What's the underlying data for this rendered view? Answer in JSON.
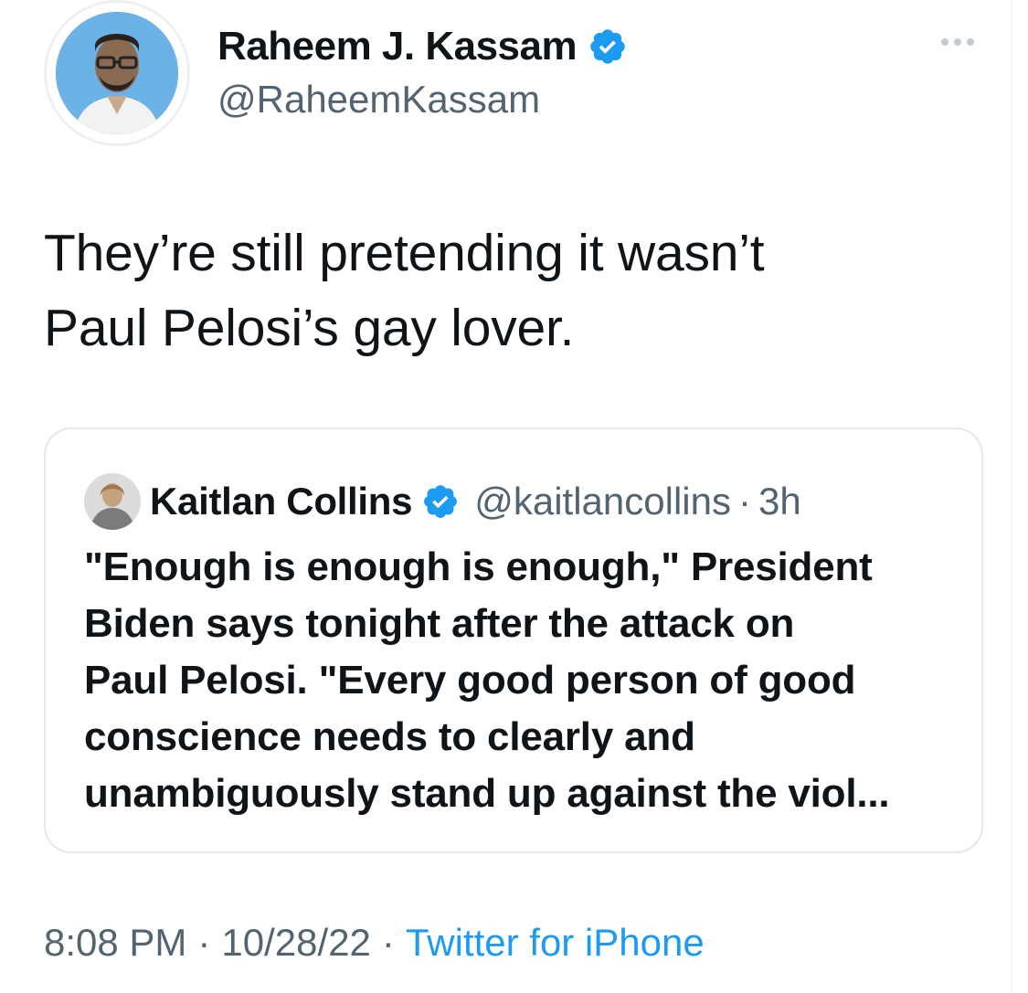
{
  "author": {
    "name": "Raheem J. Kassam",
    "handle": "@RaheemKassam",
    "verified": true
  },
  "tweet": {
    "text_line1": "They’re still pretending it wasn’t",
    "text_line2": "Paul Pelosi’s gay lover."
  },
  "quoted_tweet": {
    "name": "Kaitlan Collins",
    "handle": "@kaitlancollins",
    "separator": "·",
    "time": "3h",
    "verified": true,
    "lines": [
      "\"Enough is enough is enough,\" President",
      "Biden says tonight after the attack on",
      "Paul Pelosi. \"Every good person of good",
      "conscience needs to clearly and",
      "unambiguously stand up against the viol..."
    ]
  },
  "footer": {
    "time": "8:08 PM",
    "separator": "·",
    "date": "10/28/22",
    "source": "Twitter for iPhone"
  },
  "colors": {
    "text": "#0f1419",
    "secondary": "#536471",
    "accent": "#1d9bf0",
    "border": "#e3e8ec"
  },
  "icons": [
    "verified-badge-icon",
    "more-options-icon"
  ]
}
